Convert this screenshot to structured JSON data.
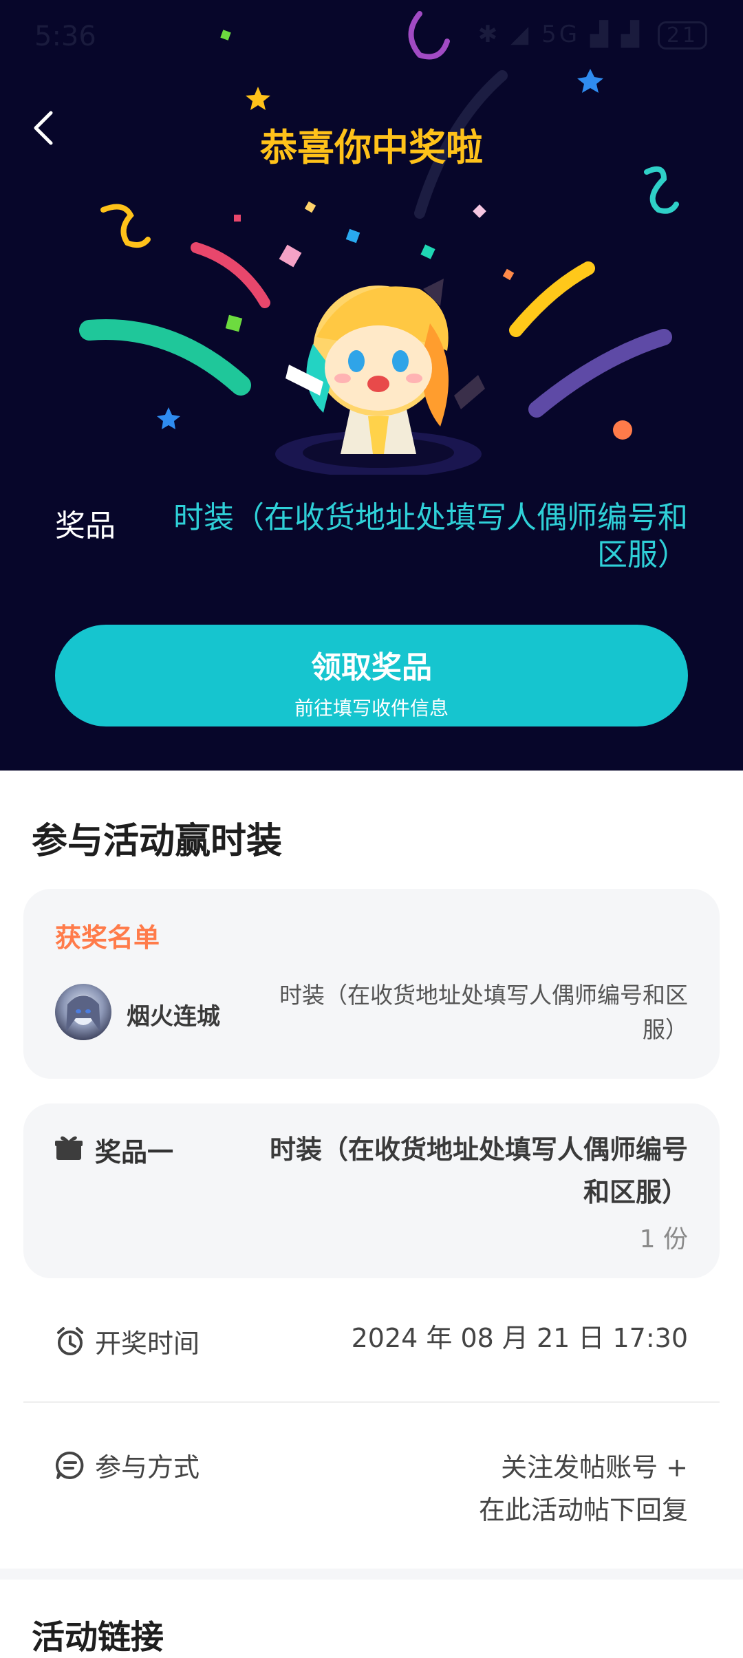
{
  "status_bar": {
    "time": "5:36",
    "icons": [
      "bluetooth-icon",
      "mute-icon",
      "signal-icon",
      "wifi-icon"
    ],
    "network_text": "5G",
    "battery": "21"
  },
  "hero": {
    "title": "恭喜你中奖啦",
    "prize_label": "奖品",
    "prize_text": "时装（在收货地址处填写人偶师编号和区服）",
    "claim_button": {
      "title": "领取奖品",
      "subtitle": "前往填写收件信息"
    },
    "colors": {
      "background": "#07062a",
      "title": "#ffc21a",
      "accent": "#16c5cf"
    }
  },
  "section_title": "参与活动赢时装",
  "winners": {
    "heading": "获奖名单",
    "items": [
      {
        "name": "烟火连城",
        "prize": "时装（在收货地址处填写人偶师编号和区服）"
      }
    ]
  },
  "prize_card": {
    "tier": "奖品一",
    "name": "时装（在收货地址处填写人偶师编号和区服）",
    "count": "1 份"
  },
  "draw_time": {
    "label": "开奖时间",
    "value": "2024 年 08 月 21 日 17:30"
  },
  "join_method": {
    "label": "参与方式",
    "line1": "关注发帖账号 +",
    "line2": "在此活动帖下回复"
  },
  "link_section": {
    "title": "活动链接"
  }
}
